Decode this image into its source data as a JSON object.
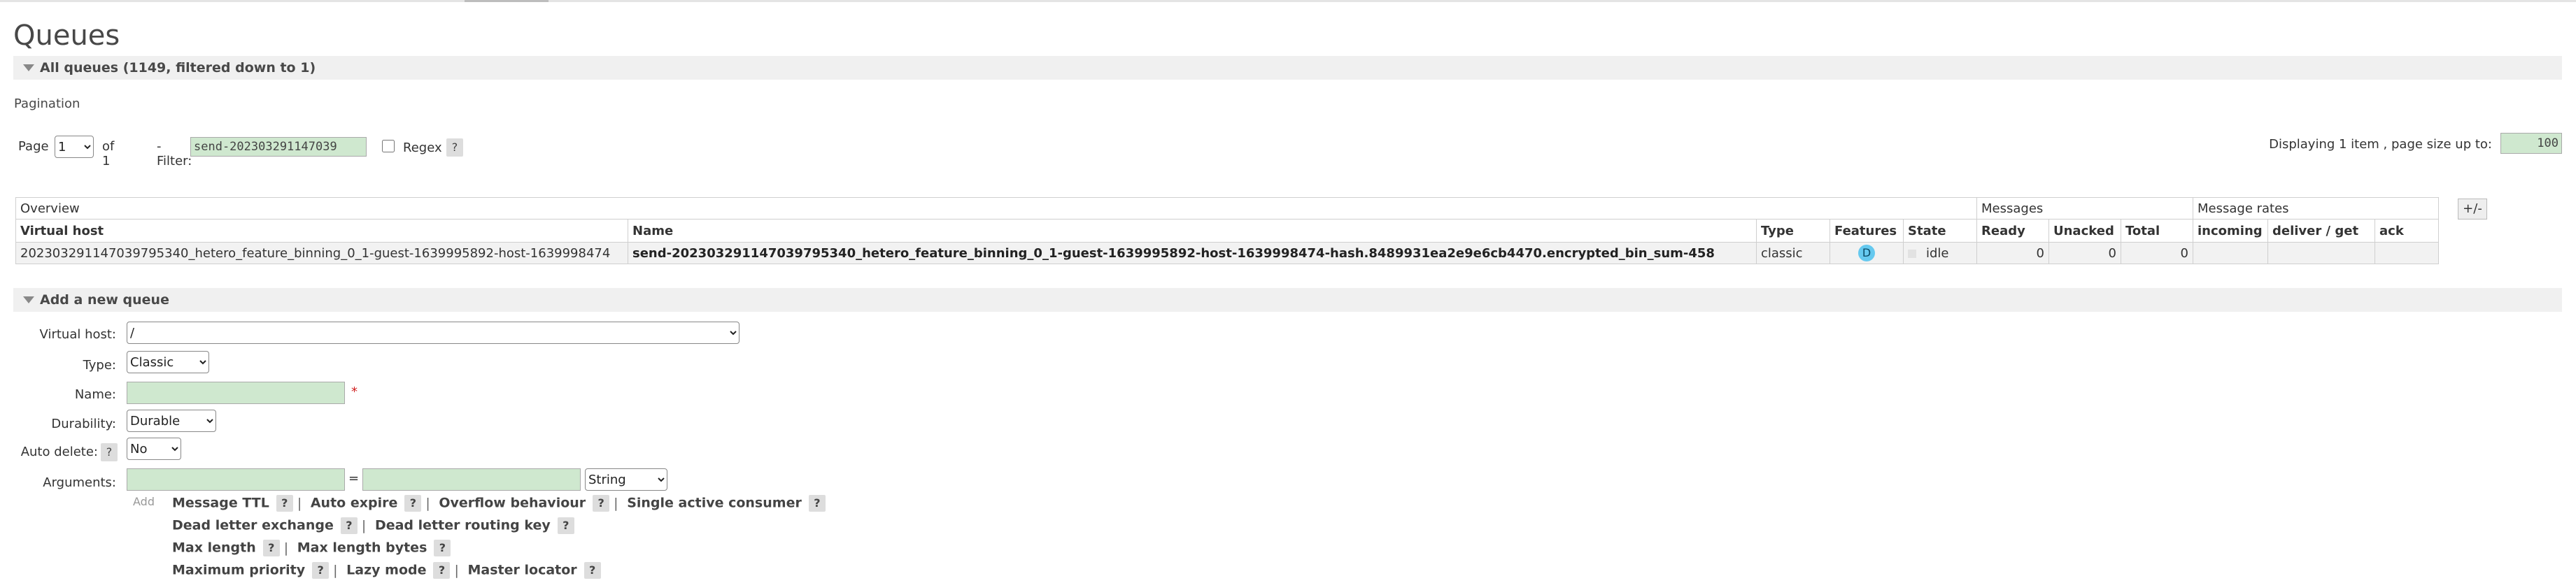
{
  "page": {
    "title": "Queues"
  },
  "all_queues": {
    "title": "All queues (1149, filtered down to 1)"
  },
  "pagination": {
    "label": "Pagination",
    "page_label": "Page",
    "page_value": "1",
    "of_label": "of 1",
    "filter_label": "- Filter:",
    "filter_value": "send-202303291147039",
    "regex_label": "Regex",
    "help": "?",
    "displaying_label": "Displaying 1 item , page size up to:",
    "page_size": "100"
  },
  "table": {
    "group_overview": "Overview",
    "group_messages": "Messages",
    "group_rates": "Message rates",
    "plus_minus": "+/-",
    "headers": {
      "vhost": "Virtual host",
      "name": "Name",
      "type": "Type",
      "features": "Features",
      "state": "State",
      "ready": "Ready",
      "unacked": "Unacked",
      "total": "Total",
      "incoming": "incoming",
      "deliver_get": "deliver / get",
      "ack": "ack"
    },
    "rows": [
      {
        "vhost": "202303291147039795340_hetero_feature_binning_0_1-guest-1639995892-host-1639998474",
        "name": "send-202303291147039795340_hetero_feature_binning_0_1-guest-1639995892-host-1639998474-hash.8489931ea2e9e6cb4470.encrypted_bin_sum-458",
        "type": "classic",
        "feature": "D",
        "state": "idle",
        "ready": "0",
        "unacked": "0",
        "total": "0"
      }
    ]
  },
  "add_queue": {
    "title": "Add a new queue",
    "vhost_label": "Virtual host:",
    "vhost_value": "/",
    "type_label": "Type:",
    "type_value": "Classic",
    "name_label": "Name:",
    "required_mark": "*",
    "durability_label": "Durability:",
    "durability_value": "Durable",
    "auto_delete_label": "Auto delete:",
    "auto_delete_value": "No",
    "arguments_label": "Arguments:",
    "equals": "=",
    "arg_type_value": "String",
    "add_label": "Add",
    "separator": "|",
    "arg_lines": [
      [
        "Message TTL",
        "Auto expire",
        "Overflow behaviour",
        "Single active consumer"
      ],
      [
        "Dead letter exchange",
        "Dead letter routing key"
      ],
      [
        "Max length",
        "Max length bytes"
      ],
      [
        "Maximum priority",
        "Lazy mode",
        "Master locator"
      ]
    ]
  },
  "colors": {
    "input_green": "#cfe8cf",
    "feature_badge": "#66c9ef",
    "section_bg": "#f0f0f0"
  }
}
